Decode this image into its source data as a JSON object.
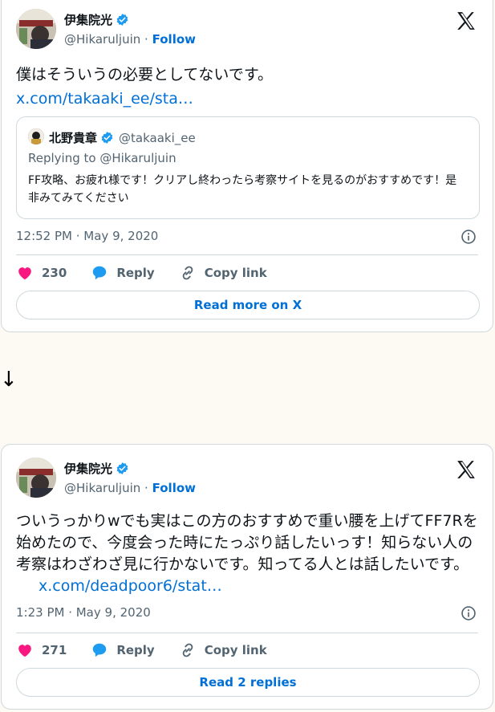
{
  "tweet1": {
    "display_name": "伊集院光",
    "handle": "@Hikaruljuin",
    "separator": "·",
    "follow_label": "Follow",
    "text": "僕はそういうの必要としてないです。",
    "link": "x.com/takaaki_ee/sta…",
    "quoted": {
      "display_name": "北野貴章",
      "handle": "@takaaki_ee",
      "replying_to": "Replying to @Hikaruljuin",
      "text": "FF攻略、お疲れ様です！クリアし終わったら考察サイトを見るのがおすすめです！是非みてみてください"
    },
    "timestamp": "12:52 PM · May 9, 2020",
    "likes": "230",
    "reply_label": "Reply",
    "copy_label": "Copy link",
    "more_label": "Read more on X"
  },
  "arrow": "↓",
  "tweet2": {
    "display_name": "伊集院光",
    "handle": "@Hikaruljuin",
    "separator": "·",
    "follow_label": "Follow",
    "text": "ついうっかりwでも実はこの方のおすすめで重い腰を上げてFF7Rを始めたので、今度会った時にたっぷり話したいっす！知らない人の考察はわざわざ見に行かないです。知ってる人とは話したいです。",
    "link": "x.com/deadpoor6/stat…",
    "timestamp": "1:23 PM · May 9, 2020",
    "likes": "271",
    "reply_label": "Reply",
    "copy_label": "Copy link",
    "more_label": "Read 2 replies"
  },
  "colors": {
    "accent": "#006fd6",
    "like": "#f91880",
    "verified": "#1d9bf0",
    "reply_icon": "#1d9bf0",
    "secondary_text": "#536471",
    "border": "#cfd9de"
  },
  "icons": {
    "verified": "verified-badge-icon",
    "logo": "x-logo-icon",
    "info": "info-icon",
    "like": "heart-icon",
    "reply": "speech-bubble-icon",
    "copy": "link-icon"
  }
}
